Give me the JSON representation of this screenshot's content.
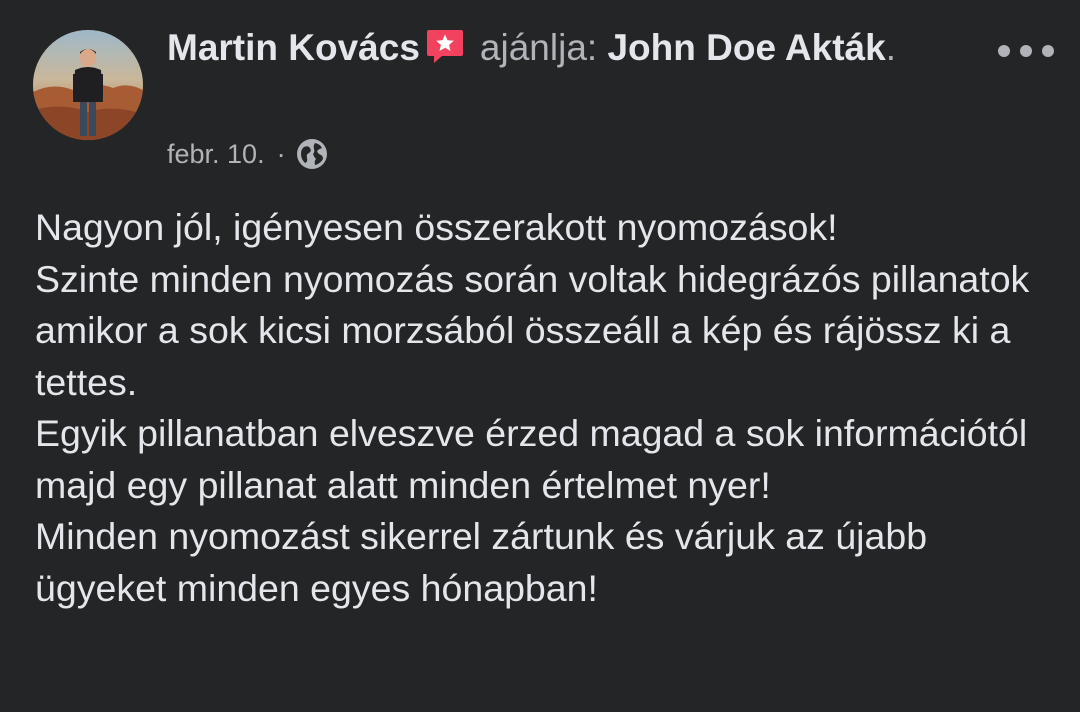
{
  "post": {
    "author": "Martin Kovács",
    "recommends_label": "ajánlja:",
    "page_name": "John Doe Akták",
    "page_suffix": ".",
    "date": "febr. 10.",
    "separator": "·",
    "privacy_icon": "globe-icon",
    "badge_icon": "recommendation-star-icon",
    "more_icon": "more-options-icon",
    "body_lines": [
      "Nagyon jól, igényesen összerakott nyomozások!",
      "Szinte minden nyomozás során voltak hidegrázós pillanatok amikor a sok kicsi morzsából összeáll a kép és rájössz ki a tettes.",
      "Egyik pillanatban elveszve érzed magad a sok információtól majd egy pillanat alatt minden értelmet nyer!",
      "Minden nyomozást sikerrel zártunk és várjuk az újabb ügyeket minden egyes hónapban!"
    ]
  },
  "colors": {
    "background": "#242526",
    "primary_text": "#e4e6eb",
    "secondary_text": "#b0b3b8",
    "badge": "#f3425f"
  }
}
